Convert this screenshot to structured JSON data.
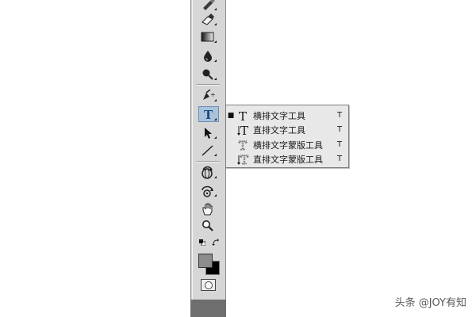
{
  "toolbar": {
    "tools": [
      {
        "name": "smudge-brush-tool-icon"
      },
      {
        "name": "eraser-tool-icon"
      },
      {
        "name": "gradient-tool-icon"
      },
      {
        "name": "blur-drop-tool-icon"
      },
      {
        "name": "dodge-tool-icon"
      },
      {
        "name": "pen-tool-icon"
      },
      {
        "name": "type-tool-icon",
        "selected": true
      },
      {
        "name": "path-selection-tool-icon"
      },
      {
        "name": "line-tool-icon"
      },
      {
        "name": "3d-rotate-tool-icon"
      },
      {
        "name": "3d-orbit-tool-icon"
      },
      {
        "name": "hand-tool-icon"
      },
      {
        "name": "zoom-tool-icon"
      }
    ],
    "foreground_color": "#8c8c8c",
    "background_color": "#000000"
  },
  "flyout": {
    "items": [
      {
        "label": "横排文字工具",
        "shortcut": "T",
        "icon": "horizontal-type-icon",
        "active": true
      },
      {
        "label": "直排文字工具",
        "shortcut": "T",
        "icon": "vertical-type-icon",
        "active": false
      },
      {
        "label": "横排文字蒙版工具",
        "shortcut": "T",
        "icon": "horizontal-type-mask-icon",
        "active": false
      },
      {
        "label": "直排文字蒙版工具",
        "shortcut": "T",
        "icon": "vertical-type-mask-icon",
        "active": false
      }
    ],
    "active_bullet": "■"
  },
  "watermark": {
    "text": "头条 @JOY有知"
  }
}
